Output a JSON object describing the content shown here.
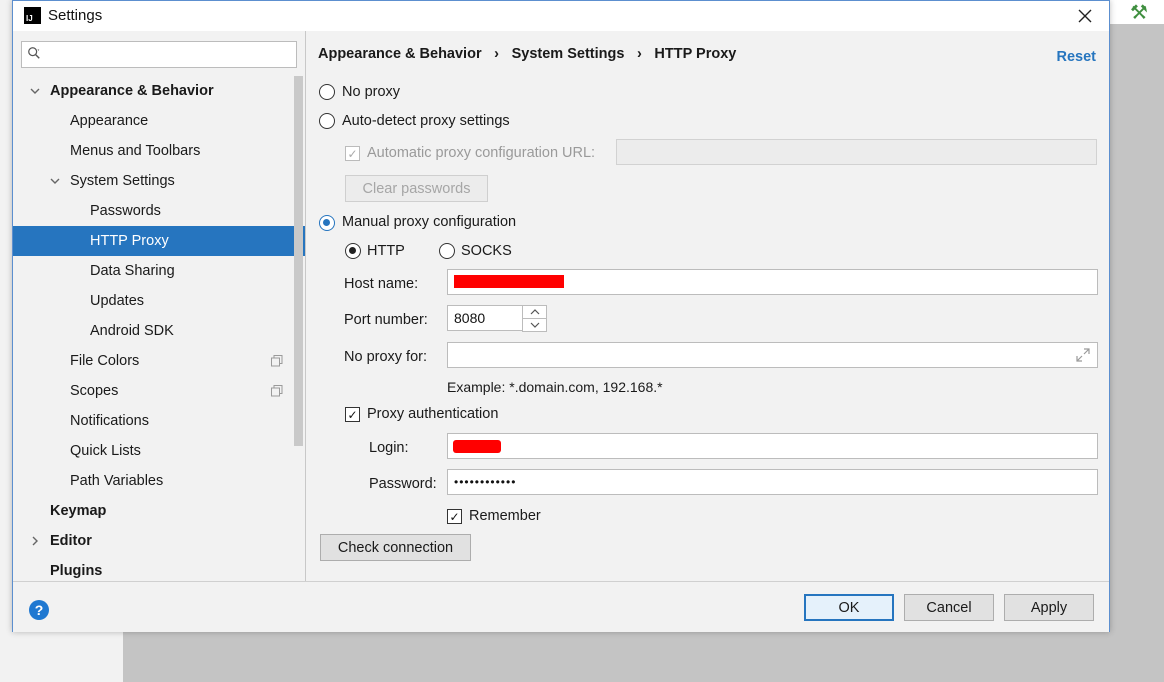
{
  "window": {
    "title": "Settings"
  },
  "search": {
    "placeholder": ""
  },
  "tree": {
    "appearance_behavior": "Appearance & Behavior",
    "appearance": "Appearance",
    "menus_toolbars": "Menus and Toolbars",
    "system_settings": "System Settings",
    "passwords": "Passwords",
    "http_proxy": "HTTP Proxy",
    "data_sharing": "Data Sharing",
    "updates": "Updates",
    "android_sdk": "Android SDK",
    "file_colors": "File Colors",
    "scopes": "Scopes",
    "notifications": "Notifications",
    "quick_lists": "Quick Lists",
    "path_variables": "Path Variables",
    "keymap": "Keymap",
    "editor": "Editor",
    "plugins": "Plugins"
  },
  "breadcrumb": {
    "item1": "Appearance & Behavior",
    "item2": "System Settings",
    "item3": "HTTP Proxy",
    "separator": "›"
  },
  "reset_label": "Reset",
  "proxy": {
    "no_proxy": "No proxy",
    "auto_detect": "Auto-detect proxy settings",
    "auto_config_url_label": "Automatic proxy configuration URL:",
    "auto_config_url_value": "",
    "clear_passwords": "Clear passwords",
    "manual": "Manual proxy configuration",
    "http": "HTTP",
    "socks": "SOCKS",
    "host_label": "Host name:",
    "host_value": "",
    "port_label": "Port number:",
    "port_value": "8080",
    "no_proxy_for_label": "No proxy for:",
    "no_proxy_for_value": "",
    "example": "Example: *.domain.com, 192.168.*",
    "proxy_auth": "Proxy authentication",
    "login_label": "Login:",
    "login_value": "",
    "password_label": "Password:",
    "password_value": "••••••••••••",
    "remember": "Remember",
    "check_connection": "Check connection"
  },
  "footer": {
    "help": "?",
    "ok": "OK",
    "cancel": "Cancel",
    "apply": "Apply"
  },
  "colors": {
    "accent": "#2675bf",
    "panel_bg": "#f2f2f2",
    "redaction": "#ff0000"
  }
}
